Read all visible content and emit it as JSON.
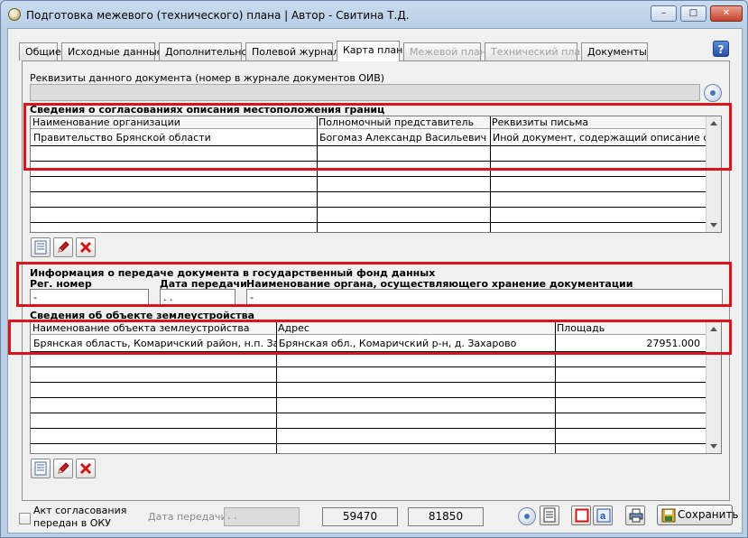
{
  "window": {
    "title": "Подготовка межевого (технического) плана | Автор - Свитина Т.Д.",
    "minimize_glyph": "–",
    "maximize_glyph": "□",
    "close_glyph": "✕"
  },
  "tabs": [
    {
      "label": "Общие",
      "state": "normal"
    },
    {
      "label": "Исходные данные",
      "state": "normal"
    },
    {
      "label": "Дополнительно",
      "state": "normal"
    },
    {
      "label": "Полевой журнал",
      "state": "normal"
    },
    {
      "label": "Карта план",
      "state": "active"
    },
    {
      "label": "Межевой план",
      "state": "disabled"
    },
    {
      "label": "Технический план",
      "state": "disabled"
    },
    {
      "label": "Документы",
      "state": "normal"
    }
  ],
  "help_glyph": "?",
  "requisites": {
    "label": "Реквизиты данного документа (номер в журнале документов ОИВ)",
    "value": ""
  },
  "approvals": {
    "title": "Сведения о согласованиях описания местоположения границ",
    "columns": [
      "Наименование организации",
      "Полномочный представитель",
      "Реквизиты письма"
    ],
    "rows": [
      [
        "Правительство Брянской области",
        "Богомаз Александр Васильевич",
        "Иной документ, содержащий описание объек"
      ]
    ]
  },
  "transfer": {
    "title": "Информация о передаче документа в государственный фонд данных",
    "reg_label": "Рег. номер",
    "reg_value": "-",
    "date_label": "Дата передачи",
    "date_value": " .  .",
    "org_label": "Наименование органа, осуществляющего хранение документации",
    "org_value": "-"
  },
  "object": {
    "title": "Сведения об объекте землеустройства",
    "columns": [
      "Наименование объекта землеустройства",
      "Адрес",
      "Площадь"
    ],
    "rows": [
      [
        "Брянская область, Комаричский район, н.п. Захаров",
        "Брянская обл., Комаричский р-н, д. Захарово",
        "27951.000"
      ]
    ]
  },
  "footer": {
    "act_label_line1": "Акт согласования",
    "act_label_line2": "передан в ОКУ",
    "date_label": "Дата передачи",
    "date_value": " .  .",
    "num1": "59470",
    "num2": "81850",
    "save_label": "Сохранить"
  },
  "colors": {
    "highlight": "#d9141b",
    "accent": "#2451a5"
  }
}
